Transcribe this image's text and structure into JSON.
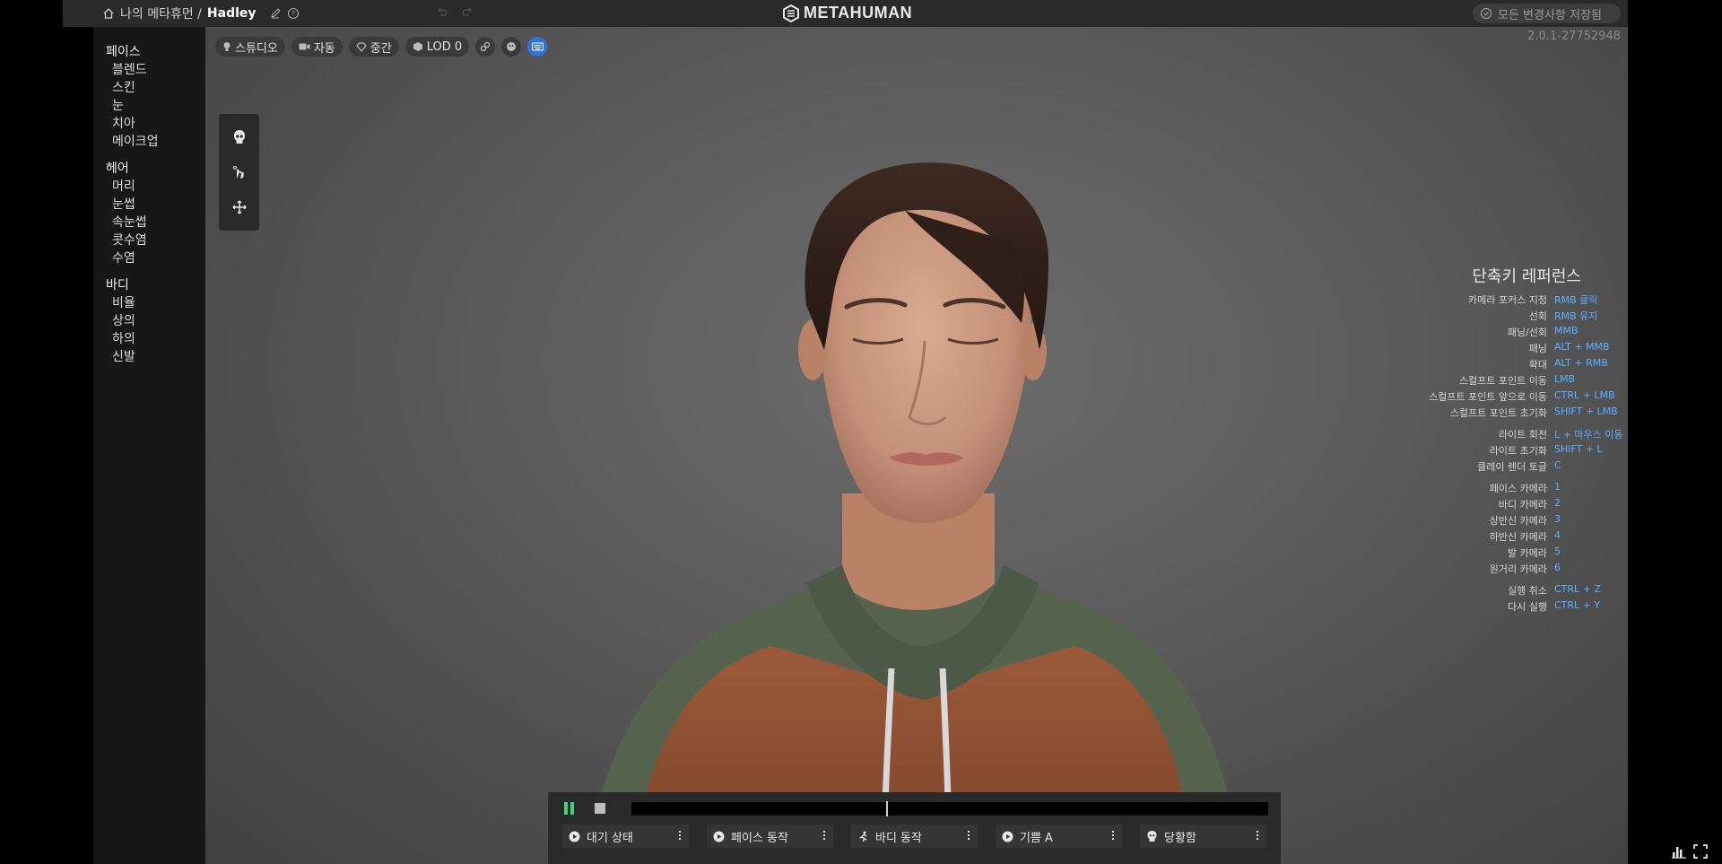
{
  "header": {
    "breadcrumb_root": "나의 메타휴먼 /",
    "character_name": "Hadley",
    "logo_text": "METAHUMAN",
    "save_status": "모든 변경사항 저장됨"
  },
  "sidebar": {
    "groups": [
      {
        "title": "페이스",
        "items": [
          "블렌드",
          "스킨",
          "눈",
          "치아",
          "메이크업"
        ]
      },
      {
        "title": "헤어",
        "items": [
          "머리",
          "눈썹",
          "속눈썹",
          "콧수염",
          "수염"
        ]
      },
      {
        "title": "바디",
        "items": [
          "비율",
          "상의",
          "하의",
          "신발"
        ]
      }
    ]
  },
  "viewport": {
    "version": "2.0.1-27752948",
    "toolbar": {
      "lighting": "스튜디오",
      "camera": "자동",
      "quality": "중간",
      "lod": "LOD 0"
    }
  },
  "shortcuts": {
    "title": "단축키 레퍼런스",
    "rows": [
      {
        "label": "카메라 포커스 지정",
        "key": "RMB 클릭"
      },
      {
        "label": "선회",
        "key": "RMB 유지"
      },
      {
        "label": "패닝/선회",
        "key": "MMB"
      },
      {
        "label": "패닝",
        "key": "ALT + MMB"
      },
      {
        "label": "확대",
        "key": "ALT + RMB"
      },
      {
        "label": "스컬프트 포인트 이동",
        "key": "LMB"
      },
      {
        "label": "스컬프트 포인트 앞으로 이동",
        "key": "CTRL + LMB"
      },
      {
        "label": "스컬프트 포인트 초기화",
        "key": "SHIFT + LMB"
      },
      {
        "label": "라이트 회전",
        "key": "L + 마우스 이동"
      },
      {
        "label": "라이트 초기화",
        "key": "SHIFT + L"
      },
      {
        "label": "클레이 렌더 토글",
        "key": "C"
      },
      {
        "label": "페이스 카메라",
        "key": "1"
      },
      {
        "label": "바디 카메라",
        "key": "2"
      },
      {
        "label": "상반신 카메라",
        "key": "3"
      },
      {
        "label": "하반신 카메라",
        "key": "4"
      },
      {
        "label": "발 카메라",
        "key": "5"
      },
      {
        "label": "원거리 카메라",
        "key": "6"
      },
      {
        "label": "실행 취소",
        "key": "CTRL + Z"
      },
      {
        "label": "다시 실행",
        "key": "CTRL + Y"
      }
    ]
  },
  "animation": {
    "timeline_progress": 0.4,
    "dropdowns": [
      {
        "icon": "play-circle-icon",
        "label": "대기 상태"
      },
      {
        "icon": "play-circle-icon",
        "label": "페이스 동작"
      },
      {
        "icon": "running-person-icon",
        "label": "바디 동작"
      },
      {
        "icon": "play-circle-icon",
        "label": "기쁨 A"
      },
      {
        "icon": "face-icon",
        "label": "당황함"
      }
    ]
  },
  "colors": {
    "accent": "#2d73d9",
    "shortcut_key": "#5ab0ff",
    "play": "#3fd47a"
  }
}
